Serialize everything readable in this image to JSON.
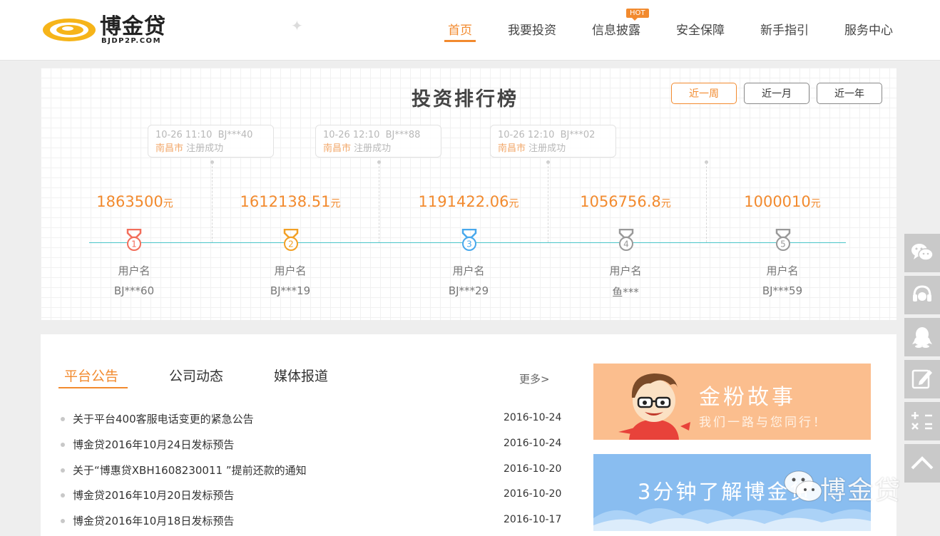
{
  "header": {
    "logo_text": "博金贷",
    "logo_sub": "BJDP2P.COM",
    "nav": [
      {
        "label": "首页",
        "active": true
      },
      {
        "label": "我要投资"
      },
      {
        "label": "信息披露",
        "badge": "HOT"
      },
      {
        "label": "安全保障"
      },
      {
        "label": "新手指引"
      },
      {
        "label": "服务中心"
      }
    ]
  },
  "ranking": {
    "title": "投资排行榜",
    "periods": [
      {
        "label": "近一周",
        "active": true
      },
      {
        "label": "近一月"
      },
      {
        "label": "近一年"
      }
    ],
    "feed": [
      {
        "time": "10-26 11:10",
        "user": "BJ***40",
        "city": "南昌市",
        "event": "注册成功"
      },
      {
        "time": "10-26 12:10",
        "user": "BJ***88",
        "city": "南昌市",
        "event": "注册成功"
      },
      {
        "time": "10-26 12:10",
        "user": "BJ***02",
        "city": "南昌市",
        "event": "注册成功"
      }
    ],
    "unit": "元",
    "user_label": "用户名",
    "entries": [
      {
        "rank": "1",
        "amount": "1863500",
        "user": "BJ***60"
      },
      {
        "rank": "2",
        "amount": "1612138.51",
        "user": "BJ***19"
      },
      {
        "rank": "3",
        "amount": "1191422.06",
        "user": "BJ***29"
      },
      {
        "rank": "4",
        "amount": "1056756.8",
        "user": "鱼***"
      },
      {
        "rank": "5",
        "amount": "1000010",
        "user": "BJ***59"
      }
    ],
    "medal_colors": [
      "#f26e5b",
      "#f2a025",
      "#48a8ec",
      "#999999",
      "#999999"
    ]
  },
  "news": {
    "tabs": [
      {
        "label": "平台公告",
        "active": true
      },
      {
        "label": "公司动态"
      },
      {
        "label": "媒体报道"
      }
    ],
    "more": "更多>",
    "items": [
      {
        "title": "关于平台400客服电话变更的紧急公告",
        "date": "2016-10-24"
      },
      {
        "title": "博金贷2016年10月24日发标预告",
        "date": "2016-10-24"
      },
      {
        "title": "关于“博惠贷XBH1608230011 ”提前还款的通知",
        "date": "2016-10-20"
      },
      {
        "title": "博金贷2016年10月20日发标预告",
        "date": "2016-10-20"
      },
      {
        "title": "博金贷2016年10月18日发标预告",
        "date": "2016-10-17"
      }
    ],
    "banner1": {
      "title": "金粉故事",
      "subtitle": "我们一路与您同行！"
    },
    "banner2": {
      "title": "3分钟了解博金贷"
    }
  },
  "watermark": {
    "text": "博金贷"
  },
  "colors": {
    "accent": "#f28a2e",
    "timeline": "#48c5c8",
    "side_bar": "#c9c9c9"
  }
}
